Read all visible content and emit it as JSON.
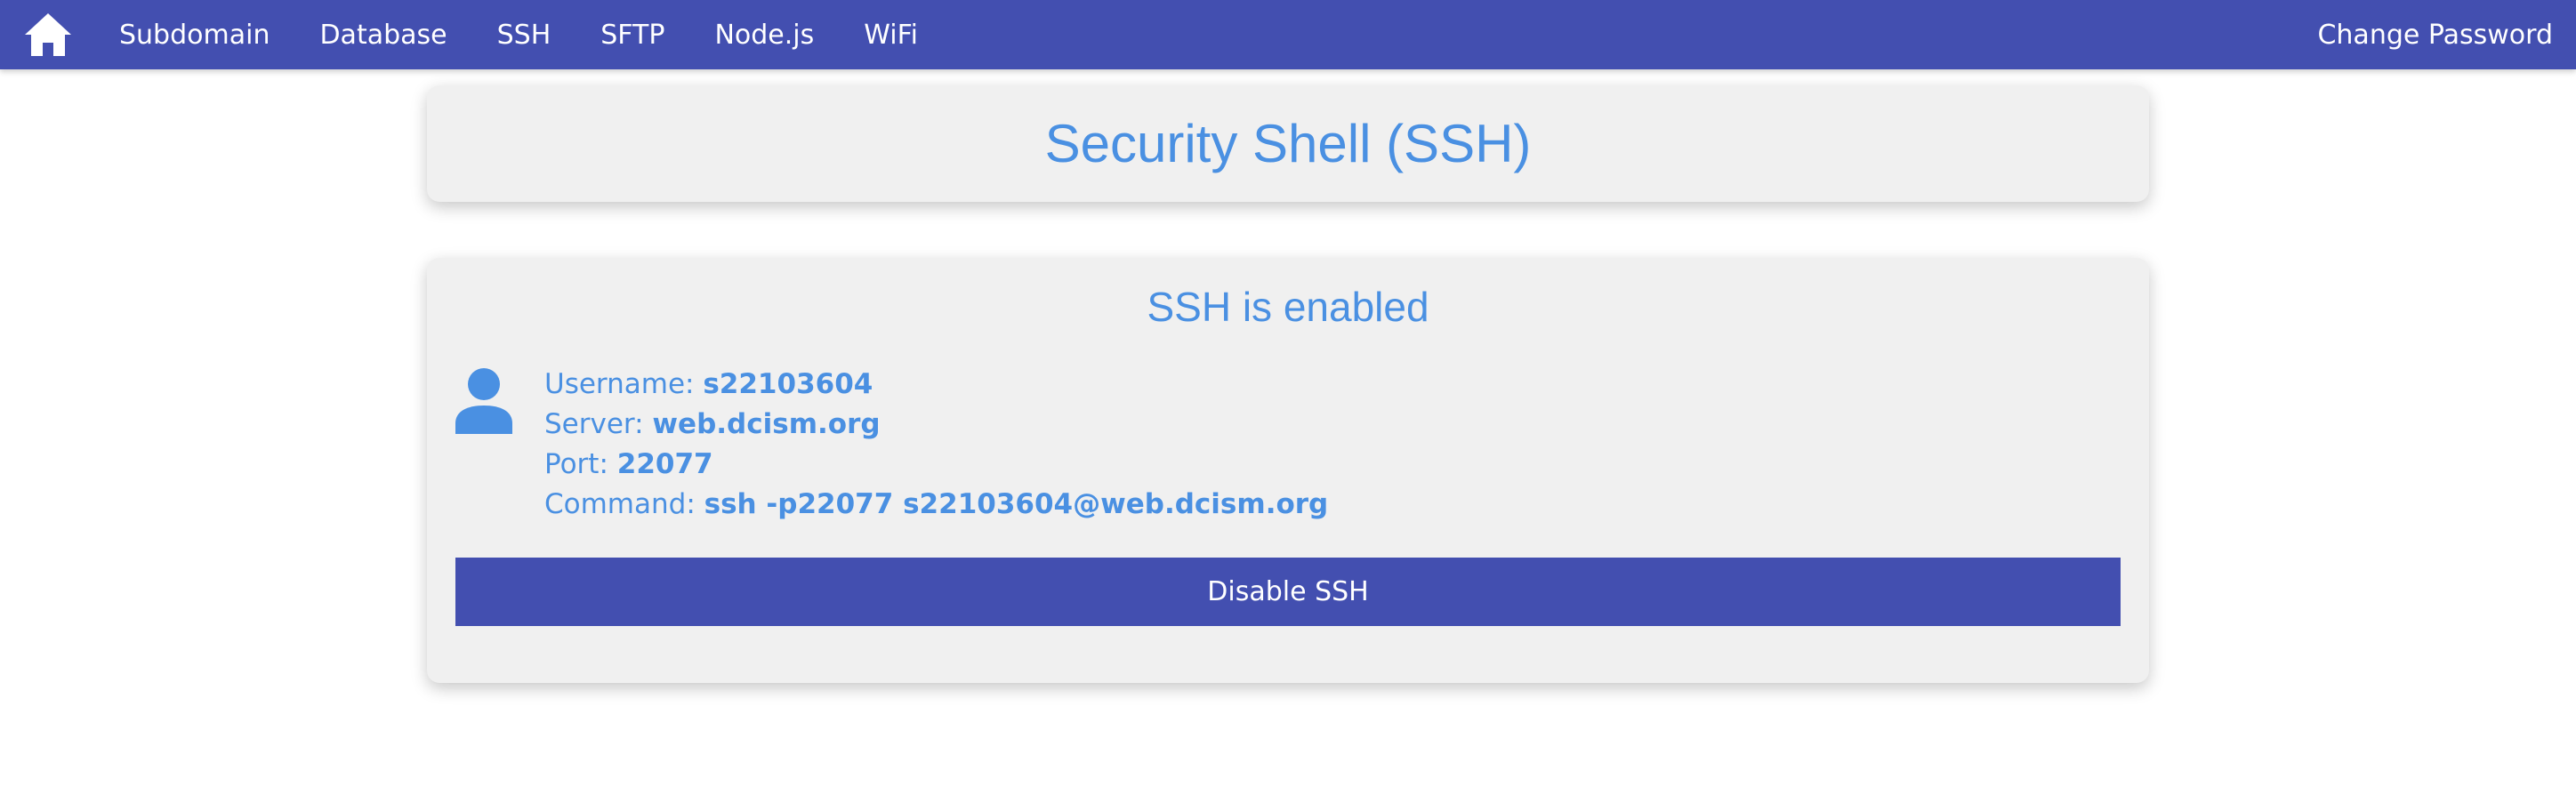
{
  "nav": {
    "home_icon": "home-icon",
    "items": [
      {
        "label": "Subdomain"
      },
      {
        "label": "Database"
      },
      {
        "label": "SSH"
      },
      {
        "label": "SFTP"
      },
      {
        "label": "Node.js"
      },
      {
        "label": "WiFi"
      }
    ],
    "right_label": "Change Password"
  },
  "page": {
    "title": "Security Shell (SSH)"
  },
  "ssh": {
    "status": "SSH is enabled",
    "user_icon": "user-icon",
    "username_label": "Username:",
    "username": "s22103604",
    "server_label": "Server:",
    "server": "web.dcism.org",
    "port_label": "Port:",
    "port": "22077",
    "command_label": "Command:",
    "command": "ssh -p22077 s22103604@web.dcism.org",
    "disable_label": "Disable SSH"
  },
  "colors": {
    "nav_bg": "#434fb0",
    "accent": "#4a90e2",
    "card_bg": "#f0f0f0"
  }
}
